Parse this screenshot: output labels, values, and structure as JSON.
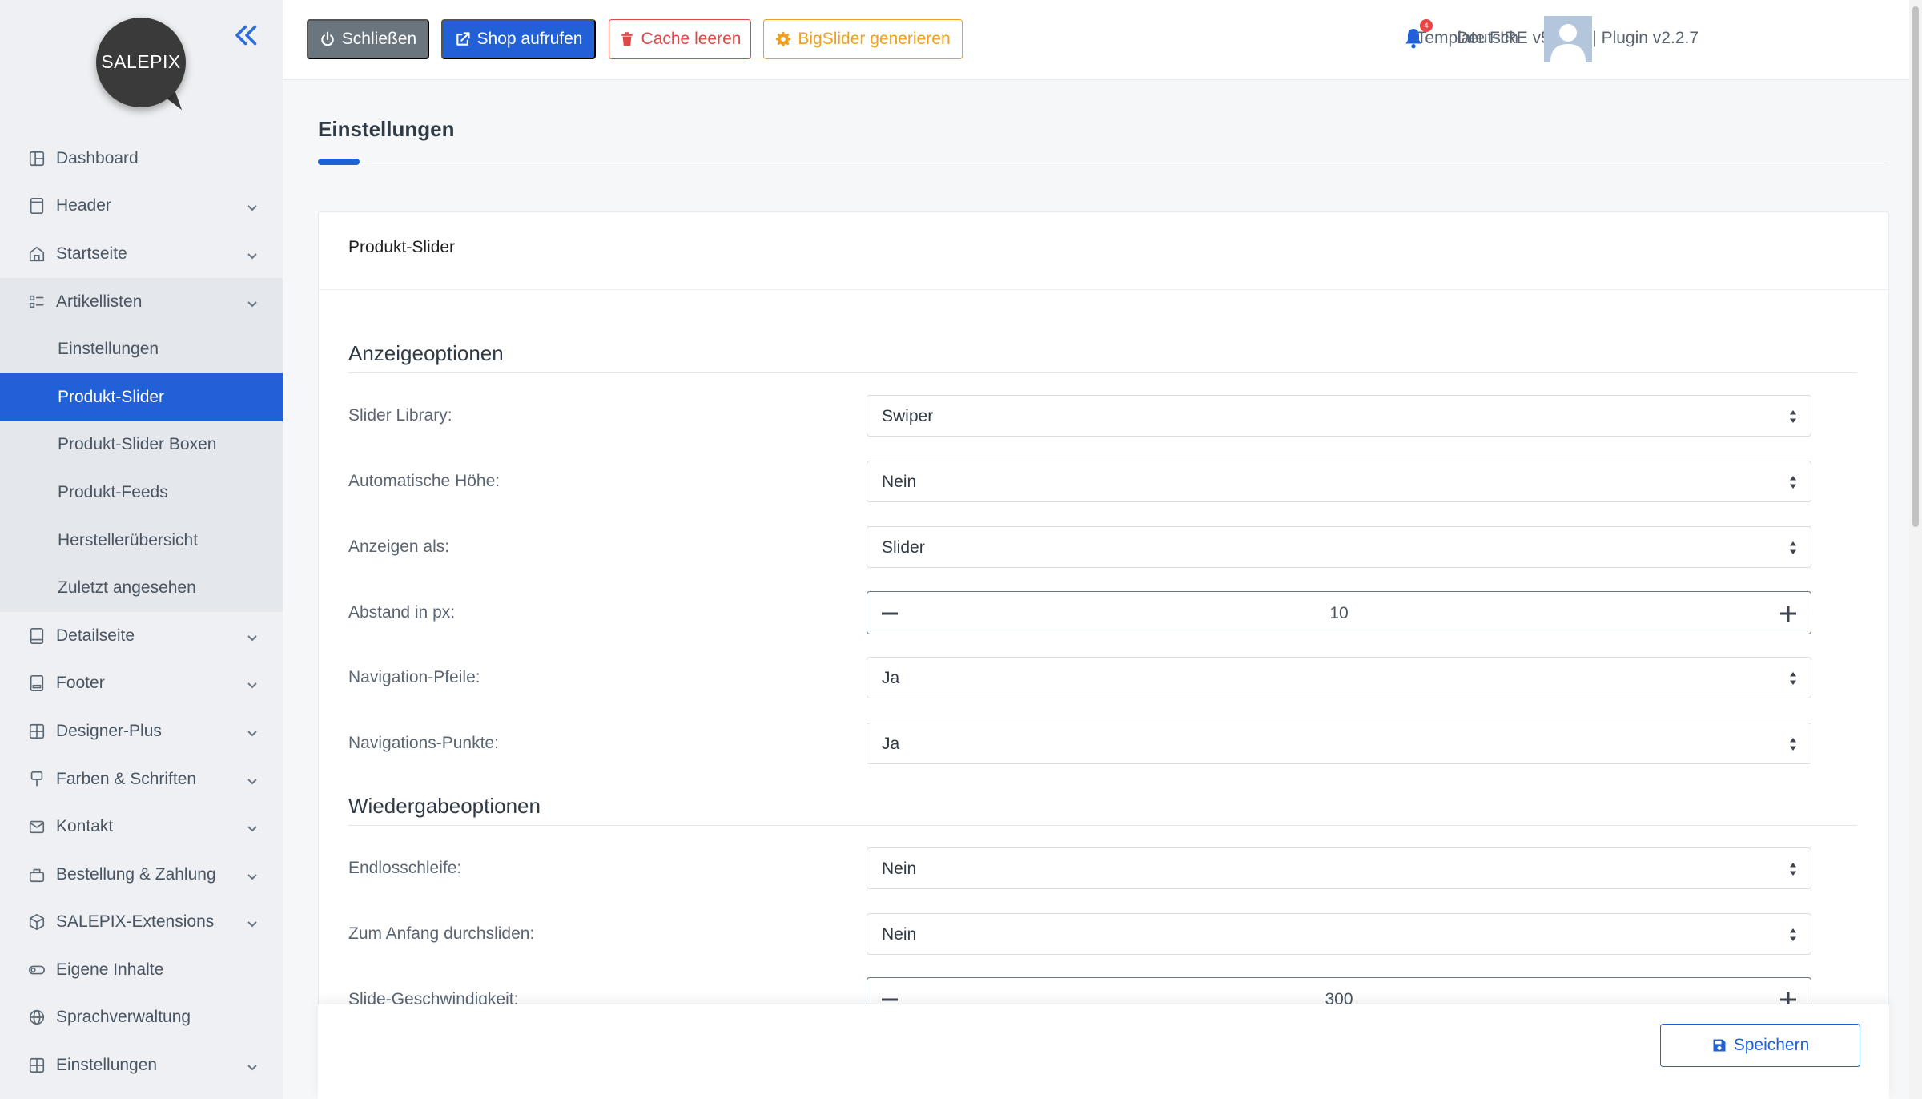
{
  "sidebar": {
    "logo_text": "SALEPIX",
    "items": [
      {
        "label": "Dashboard",
        "icon": "dashboard-icon",
        "has_children": false
      },
      {
        "label": "Header",
        "icon": "header-icon",
        "has_children": true
      },
      {
        "label": "Startseite",
        "icon": "home-icon",
        "has_children": true
      },
      {
        "label": "Artikellisten",
        "icon": "list-icon",
        "has_children": true,
        "expanded": true
      },
      {
        "label": "Detailseite",
        "icon": "page-icon",
        "has_children": true
      },
      {
        "label": "Footer",
        "icon": "footer-icon",
        "has_children": true
      },
      {
        "label": "Designer-Plus",
        "icon": "grid-icon",
        "has_children": true
      },
      {
        "label": "Farben & Schriften",
        "icon": "brush-icon",
        "has_children": true
      },
      {
        "label": "Kontakt",
        "icon": "mail-icon",
        "has_children": true
      },
      {
        "label": "Bestellung & Zahlung",
        "icon": "basket-icon",
        "has_children": true
      },
      {
        "label": "SALEPIX-Extensions",
        "icon": "box-icon",
        "has_children": true
      },
      {
        "label": "Eigene Inhalte",
        "icon": "toggle-icon",
        "has_children": false
      },
      {
        "label": "Sprachverwaltung",
        "icon": "globe-icon",
        "has_children": false
      },
      {
        "label": "Einstellungen",
        "icon": "settings-grid-icon",
        "has_children": true
      }
    ],
    "subitems": [
      {
        "label": "Einstellungen",
        "active": false
      },
      {
        "label": "Produkt-Slider",
        "active": true
      },
      {
        "label": "Produkt-Slider Boxen",
        "active": false
      },
      {
        "label": "Produkt-Feeds",
        "active": false
      },
      {
        "label": "Herstellerübersicht",
        "active": false
      },
      {
        "label": "Zuletzt angesehen",
        "active": false
      }
    ]
  },
  "topbar": {
    "close_label": "Schließen",
    "shop_label": "Shop aufrufen",
    "cache_label": "Cache leeren",
    "bigslider_label": "BigSlider generieren",
    "version": "Template FIRE v5.2.38 | Plugin v2.2.7",
    "notification_count": "4",
    "language": "Deutsch"
  },
  "main": {
    "page_title": "Einstellungen",
    "card_title": "Produkt-Slider",
    "section1": "Anzeigeoptionen",
    "section2": "Wiedergabeoptionen",
    "fields": {
      "slider_library": {
        "label": "Slider Library:",
        "value": "Swiper"
      },
      "auto_height": {
        "label": "Automatische Höhe:",
        "value": "Nein"
      },
      "display_as": {
        "label": "Anzeigen als:",
        "value": "Slider"
      },
      "spacing": {
        "label": "Abstand in px:",
        "value": "10"
      },
      "nav_arrows": {
        "label": "Navigation-Pfeile:",
        "value": "Ja"
      },
      "nav_dots": {
        "label": "Navigations-Punkte:",
        "value": "Ja"
      },
      "endless": {
        "label": "Endlosschleife:",
        "value": "Nein"
      },
      "rewind": {
        "label": "Zum Anfang durchsliden:",
        "value": "Nein"
      },
      "speed": {
        "label": "Slide-Geschwindigkeit:",
        "value": "300"
      }
    },
    "save_label": "Speichern"
  },
  "colors": {
    "primary": "#2160d7",
    "danger": "#e04848",
    "warning": "#f0a020",
    "secondary": "#6a757e",
    "sidebar_bg": "#eef0f3"
  }
}
